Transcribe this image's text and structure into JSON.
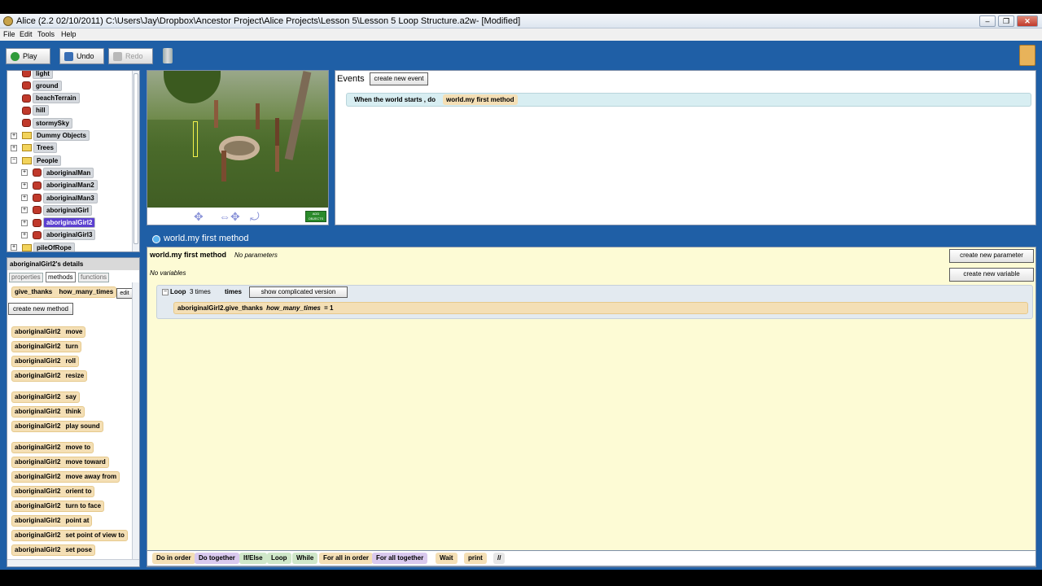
{
  "window": {
    "title": "Alice (2.2  02/10/2011) C:\\Users\\Jay\\Dropbox\\Ancestor Project\\Alice Projects\\Lesson 5\\Lesson 5 Loop Structure.a2w-  [Modified]"
  },
  "menu": {
    "file": "File",
    "edit": "Edit",
    "tools": "Tools",
    "help": "Help"
  },
  "toolbar": {
    "play": "Play",
    "undo": "Undo",
    "redo": "Redo"
  },
  "tree": {
    "items": [
      {
        "label": "light",
        "kind": "obj",
        "indent": 1
      },
      {
        "label": "ground",
        "kind": "obj",
        "indent": 1
      },
      {
        "label": "beachTerrain",
        "kind": "obj",
        "indent": 1
      },
      {
        "label": "hill",
        "kind": "obj",
        "indent": 1
      },
      {
        "label": "stormySky",
        "kind": "obj",
        "indent": 1
      },
      {
        "label": "Dummy Objects",
        "kind": "folder",
        "indent": 1,
        "exp": "+"
      },
      {
        "label": "Trees",
        "kind": "folder",
        "indent": 1,
        "exp": "+"
      },
      {
        "label": "People",
        "kind": "folder",
        "indent": 1,
        "exp": "−"
      },
      {
        "label": "aboriginalMan",
        "kind": "obj",
        "indent": 2,
        "exp": "+"
      },
      {
        "label": "aboriginalMan2",
        "kind": "obj",
        "indent": 2,
        "exp": "+"
      },
      {
        "label": "aboriginalMan3",
        "kind": "obj",
        "indent": 2,
        "exp": "+"
      },
      {
        "label": "aboriginalGirl",
        "kind": "obj",
        "indent": 2,
        "exp": "+"
      },
      {
        "label": "aboriginalGirl2",
        "kind": "obj",
        "indent": 2,
        "exp": "+",
        "selected": true
      },
      {
        "label": "aboriginalGirl3",
        "kind": "obj",
        "indent": 2,
        "exp": "+"
      },
      {
        "label": "pileOfRope",
        "kind": "folder",
        "indent": 1,
        "exp": "+"
      }
    ]
  },
  "details": {
    "title": "aboriginalGirl2's details",
    "tabs": [
      "properties",
      "methods",
      "functions"
    ],
    "custom_method": "give_thanks",
    "custom_param": "how_many_times",
    "edit": "edit",
    "create_method": "create new method",
    "methods": [
      [
        "aboriginalGirl2",
        "move"
      ],
      [
        "aboriginalGirl2",
        "turn"
      ],
      [
        "aboriginalGirl2",
        "roll"
      ],
      [
        "aboriginalGirl2",
        "resize"
      ],
      [
        "aboriginalGirl2",
        "say"
      ],
      [
        "aboriginalGirl2",
        "think"
      ],
      [
        "aboriginalGirl2",
        "play sound"
      ],
      [
        "aboriginalGirl2",
        "move to"
      ],
      [
        "aboriginalGirl2",
        "move   toward"
      ],
      [
        "aboriginalGirl2",
        "move   away from"
      ],
      [
        "aboriginalGirl2",
        "orient to"
      ],
      [
        "aboriginalGirl2",
        "turn to face"
      ],
      [
        "aboriginalGirl2",
        "point at"
      ],
      [
        "aboriginalGirl2",
        "set point of view to"
      ],
      [
        "aboriginalGirl2",
        "set pose"
      ]
    ]
  },
  "scene": {
    "add_objects": "ADD OBJECTS"
  },
  "events": {
    "title": "Events",
    "create": "create new event",
    "when": "When the world starts ,  do",
    "method": "world.my first method"
  },
  "editor": {
    "tab": "world.my first method",
    "method_name": "world.my first method",
    "no_params": "No parameters",
    "no_vars": "No variables",
    "create_param": "create new parameter",
    "create_var": "create new variable",
    "loop": "Loop",
    "loop_count": "3 times",
    "times": "times",
    "show_complicated": "show complicated version",
    "stmt_obj": "aboriginalGirl2.give_thanks",
    "stmt_param": "how_many_times",
    "stmt_val": "= 1"
  },
  "bottom": {
    "tiles": [
      {
        "label": "Do in order",
        "color": "#f4dfb5"
      },
      {
        "label": "Do together",
        "color": "#d9c9ee"
      },
      {
        "label": "If/Else",
        "color": "#cfe7c9"
      },
      {
        "label": "Loop",
        "color": "#cfe7c9"
      },
      {
        "label": "While",
        "color": "#cfe7c9"
      },
      {
        "label": "For all in order",
        "color": "#f4dfb5"
      },
      {
        "label": "For all together",
        "color": "#d9c9ee"
      },
      {
        "label": "Wait",
        "color": "#f4dfb5"
      },
      {
        "label": "print",
        "color": "#f4dfb5"
      },
      {
        "label": "//",
        "color": "#e6e6e6"
      }
    ]
  }
}
